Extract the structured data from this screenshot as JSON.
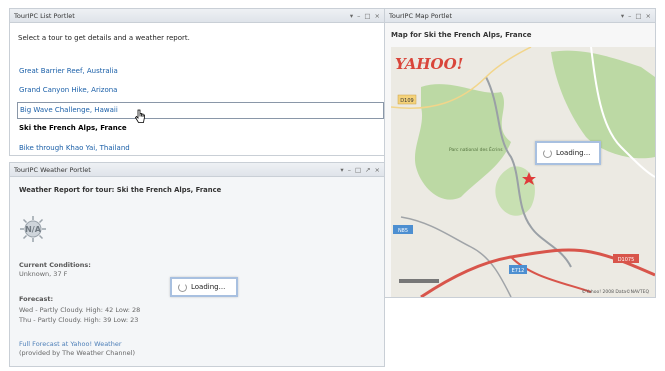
{
  "list_portlet": {
    "title": "TourIPC List Portlet",
    "controls": [
      "▾",
      "–",
      "□",
      "×"
    ],
    "intro": "Select a tour to get details and a weather report.",
    "tours": [
      "Great Barrier Reef, Australia",
      "Grand Canyon Hike, Arizona",
      "Big Wave Challenge, Hawaii",
      "Ski the French Alps, France",
      "Bike through Khao Yai, Thailand"
    ],
    "selected_tour": "Ski the French Alps, France",
    "hovered_tour": "Big Wave Challenge, Hawaii"
  },
  "weather_portlet": {
    "title": "TourIPC Weather Portlet",
    "controls": [
      "▾",
      "–",
      "□",
      "↗",
      "×"
    ],
    "heading": "Weather Report for tour: Ski the French Alps, France",
    "icon_text": "N/A",
    "current_label": "Current Conditions:",
    "current_value": "Unknown, 37 F",
    "forecast_label": "Forecast:",
    "forecast": [
      "Wed - Partly Cloudy. High: 42 Low: 28",
      "Thu - Partly Cloudy. High: 39 Low: 23"
    ],
    "link": "Full Forecast at Yahoo! Weather",
    "provider": "(provided by The Weather Channel)",
    "loading_text": "Loading..."
  },
  "map_portlet": {
    "title": "TourIPC Map Portlet",
    "controls": [
      "▾",
      "–",
      "□",
      "×"
    ],
    "heading": "Map for Ski the French Alps, France",
    "logo": "YAHOO!",
    "loading_text": "Loading...",
    "road_labels": [
      "D109",
      "N85",
      "E712",
      "D1075"
    ],
    "park_label": "Parc national des Écrins",
    "copyright": "©Yahoo! 2008 Data©NAVTEQ"
  },
  "colors": {
    "link": "#1a5fa8",
    "title_bar": "#dfe4ea",
    "border": "#c9cfd6",
    "loading_border": "#a8c0e0",
    "map_green": "#bcd9a4",
    "map_road_red": "#d8554b"
  }
}
